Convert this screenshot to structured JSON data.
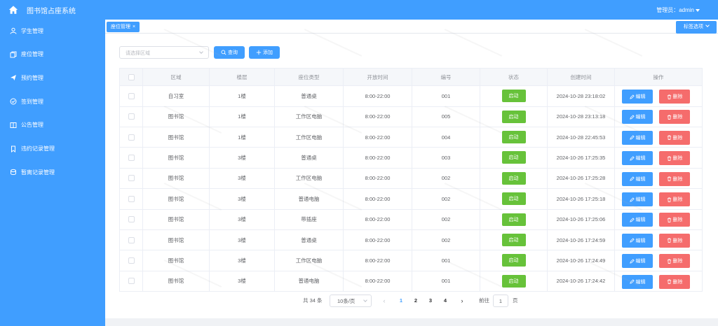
{
  "app": {
    "title": "图书馆占座系统",
    "user": "管理员：admin"
  },
  "sidebar": {
    "items": [
      {
        "label": "学生管理",
        "icon": "user-icon"
      },
      {
        "label": "座位管理",
        "icon": "copy-icon"
      },
      {
        "label": "预约管理",
        "icon": "send-icon"
      },
      {
        "label": "签到管理",
        "icon": "check-circle-icon"
      },
      {
        "label": "公告管理",
        "icon": "book-icon"
      },
      {
        "label": "违约记录管理",
        "icon": "bookmark-icon"
      },
      {
        "label": "暂离记录管理",
        "icon": "coin-icon"
      }
    ]
  },
  "tabs": {
    "active": "座位管理",
    "options_label": "标签选项"
  },
  "filter": {
    "placeholder": "请选择区域",
    "search_label": "查询",
    "add_label": "添加"
  },
  "table": {
    "headers": [
      "区域",
      "楼层",
      "座位类型",
      "开放时间",
      "编号",
      "状态",
      "创建时间",
      "操作"
    ],
    "edit_label": "编辑",
    "delete_label": "删除",
    "rows": [
      {
        "area": "自习室",
        "floor": "1楼",
        "type": "普通桌",
        "hours": "8:00-22:00",
        "number": "001",
        "status": "启动",
        "created": "2024-10-28 23:18:02"
      },
      {
        "area": "图书馆",
        "floor": "1楼",
        "type": "工作区电脑",
        "hours": "8:00-22:00",
        "number": "005",
        "status": "启动",
        "created": "2024-10-28 23:13:18"
      },
      {
        "area": "图书馆",
        "floor": "1楼",
        "type": "工作区电脑",
        "hours": "8:00-22:00",
        "number": "004",
        "status": "启动",
        "created": "2024-10-28 22:45:53"
      },
      {
        "area": "图书馆",
        "floor": "3楼",
        "type": "普通桌",
        "hours": "8:00-22:00",
        "number": "003",
        "status": "启动",
        "created": "2024-10-26 17:25:35"
      },
      {
        "area": "图书馆",
        "floor": "3楼",
        "type": "工作区电脑",
        "hours": "8:00-22:00",
        "number": "002",
        "status": "启动",
        "created": "2024-10-26 17:25:28"
      },
      {
        "area": "图书馆",
        "floor": "3楼",
        "type": "普通电脑",
        "hours": "8:00-22:00",
        "number": "002",
        "status": "启动",
        "created": "2024-10-26 17:25:18"
      },
      {
        "area": "图书馆",
        "floor": "3楼",
        "type": "带插座",
        "hours": "8:00-22:00",
        "number": "002",
        "status": "启动",
        "created": "2024-10-26 17:25:06"
      },
      {
        "area": "图书馆",
        "floor": "3楼",
        "type": "普通桌",
        "hours": "8:00-22:00",
        "number": "002",
        "status": "启动",
        "created": "2024-10-26 17:24:59"
      },
      {
        "area": "图书馆",
        "floor": "3楼",
        "type": "工作区电脑",
        "hours": "8:00-22:00",
        "number": "001",
        "status": "启动",
        "created": "2024-10-26 17:24:49"
      },
      {
        "area": "图书馆",
        "floor": "3楼",
        "type": "普通电脑",
        "hours": "8:00-22:00",
        "number": "001",
        "status": "启动",
        "created": "2024-10-26 17:24:42"
      }
    ]
  },
  "pagination": {
    "total": "共 34 条",
    "page_size": "10条/页",
    "pages": [
      "1",
      "2",
      "3",
      "4"
    ],
    "current": "1",
    "goto_prefix": "前往",
    "goto_value": "1",
    "goto_suffix": "页"
  },
  "colors": {
    "primary": "#409eff",
    "success": "#67c23a",
    "danger": "#f56c6c"
  }
}
